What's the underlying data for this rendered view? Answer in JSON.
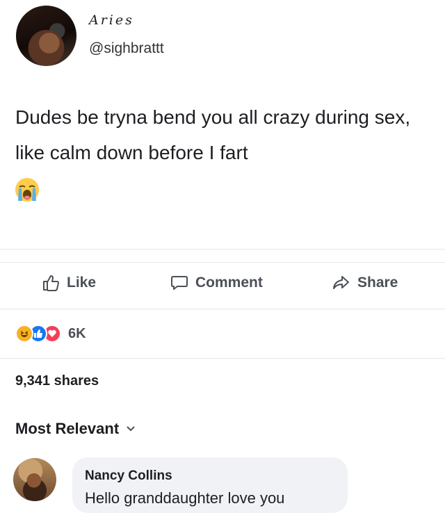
{
  "post": {
    "author_display_name": "Aries",
    "author_handle": "@sighbrattt",
    "text": "Dudes be tryna bend you all crazy during sex, like calm down before I fart",
    "emoji": "loudly-crying-face"
  },
  "actions": {
    "like_label": "Like",
    "comment_label": "Comment",
    "share_label": "Share"
  },
  "reactions": {
    "types": [
      "laughing",
      "like",
      "love"
    ],
    "count": "6K"
  },
  "shares": "9,341 shares",
  "comments_filter": "Most Relevant",
  "comments": [
    {
      "author": "Nancy Collins",
      "text": "Hello granddaughter love you"
    }
  ],
  "colors": {
    "like_blue": "#1877f2",
    "love_red": "#f33e58",
    "haha_yellow": "#f7b125",
    "bubble_gray": "#f0f2f5",
    "action_gray": "#4b4f56"
  }
}
